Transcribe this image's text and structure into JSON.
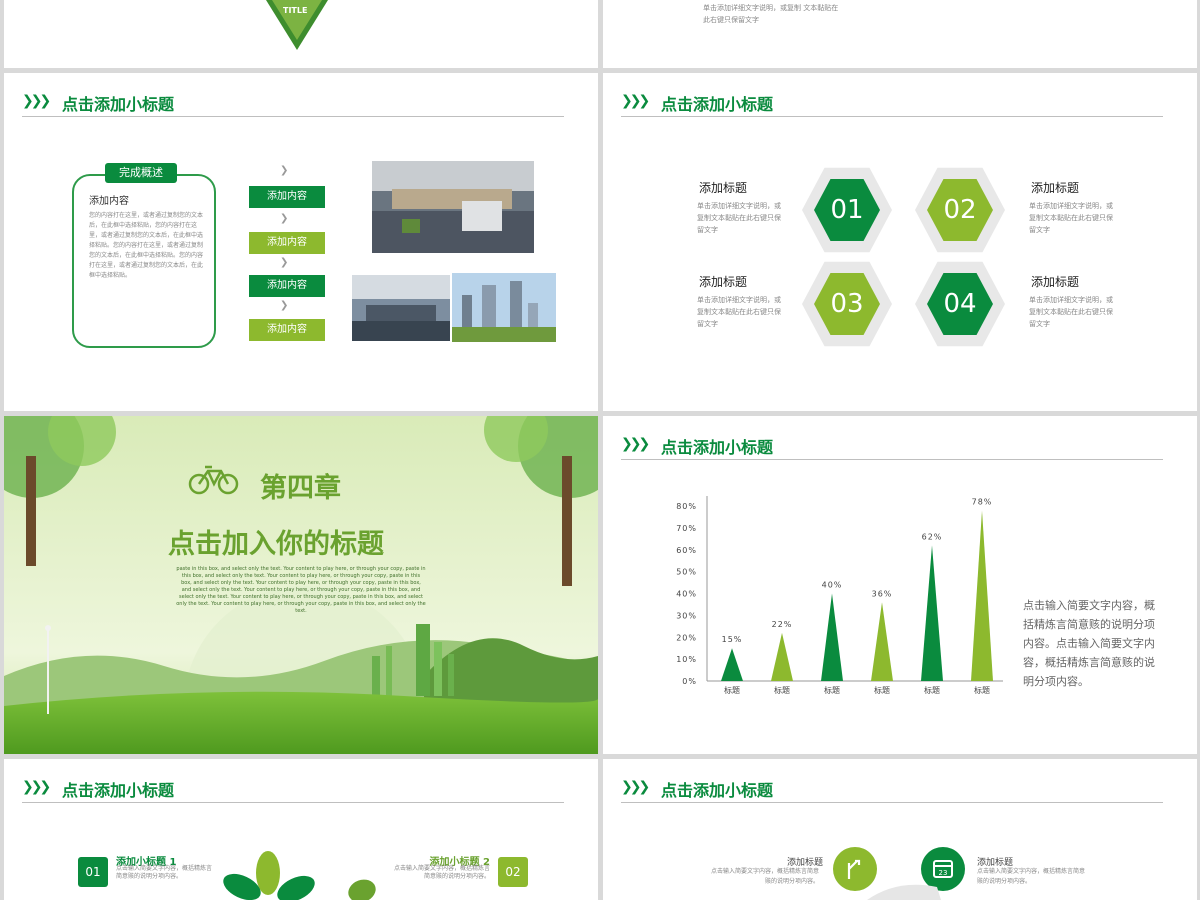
{
  "top_left": {
    "badge": "TITLE"
  },
  "top_right": {
    "text": "单击添加详细文字说明，或复制 文本黏贴在此右键只保留文字"
  },
  "section_header": "点击添加小标题",
  "slide1": {
    "tag": "完成概述",
    "title": "添加内容",
    "body": "您的内容打在这里，或者通过复制您的文本后，在此框中选择粘贴，您的内容打在这里，或者通过复制您的文本后，在此框中选择粘贴。您的内容打在这里，或者通过复制您的文本后，在此框中选择粘贴。您的内容打在这里，或者通过复制您的文本后，在此框中选择粘贴。",
    "steps": [
      "添加内容",
      "添加内容",
      "添加内容",
      "添加内容"
    ]
  },
  "slide2": {
    "items": [
      {
        "num": "01",
        "title": "添加标题",
        "body": "单击添加详细文字说明，或复制文本黏贴在此右键只保留文字"
      },
      {
        "num": "02",
        "title": "添加标题",
        "body": "单击添加详细文字说明，或复制文本黏贴在此右键只保留文字"
      },
      {
        "num": "03",
        "title": "添加标题",
        "body": "单击添加详细文字说明，或复制文本黏贴在此右键只保留文字"
      },
      {
        "num": "04",
        "title": "添加标题",
        "body": "单击添加详细文字说明，或复制文本黏贴在此右键只保留文字"
      }
    ]
  },
  "slide3": {
    "chapter": "第四章",
    "title": "点击加入你的标题",
    "body": "paste in this box, and select only the text. Your content to play here, or through your copy, paste in this box, and select only the text. Your content to play here, or through your copy, paste in this box, and select only the text. Your content to play here, or through your copy, paste in this box, and select only the text. Your content to play here, or through your copy, paste in this box, and select only the text. Your content to play here, or through your copy, paste in this box, and select only the text. Your content to play here, or through your copy, paste in this box, and select only the text."
  },
  "slide4": {
    "description": "点击输入简要文字内容，概括精炼言简意赅的说明分项内容。点击输入简要文字内容，概括精炼言简意赅的说明分项内容。"
  },
  "chart_data": {
    "type": "bar",
    "categories": [
      "标题",
      "标题",
      "标题",
      "标题",
      "标题",
      "标题"
    ],
    "values": [
      15,
      22,
      40,
      36,
      62,
      78
    ],
    "value_labels": [
      "15%",
      "22%",
      "40%",
      "36%",
      "62%",
      "78%"
    ],
    "y_ticks": [
      "0%",
      "10%",
      "20%",
      "30%",
      "40%",
      "50%",
      "60%",
      "70%",
      "80%"
    ],
    "ylim": [
      0,
      80
    ],
    "colors": [
      "#0a8b3e",
      "#8db92e"
    ],
    "grid": false
  },
  "slide5": {
    "items": [
      {
        "num": "01",
        "title": "添加小标题 1",
        "body": "点击输入简要文字内容，概括精炼言简意赅的说明分项内容。"
      },
      {
        "num": "02",
        "title": "添加小标题 2",
        "body": "点击输入简要文字内容，概括精炼言简意赅的说明分项内容。"
      }
    ]
  },
  "slide6": {
    "items": [
      {
        "title": "添加标题",
        "body": "点击输入简要文字内容，概括精炼言简意赅的说明分项内容。"
      },
      {
        "title": "添加标题",
        "body": "点击输入简要文字内容，概括精炼言简意赅的说明分项内容。"
      }
    ],
    "calendar_day": "23"
  },
  "colors": {
    "dark_green": "#0a8b3e",
    "light_green": "#8db92e"
  }
}
